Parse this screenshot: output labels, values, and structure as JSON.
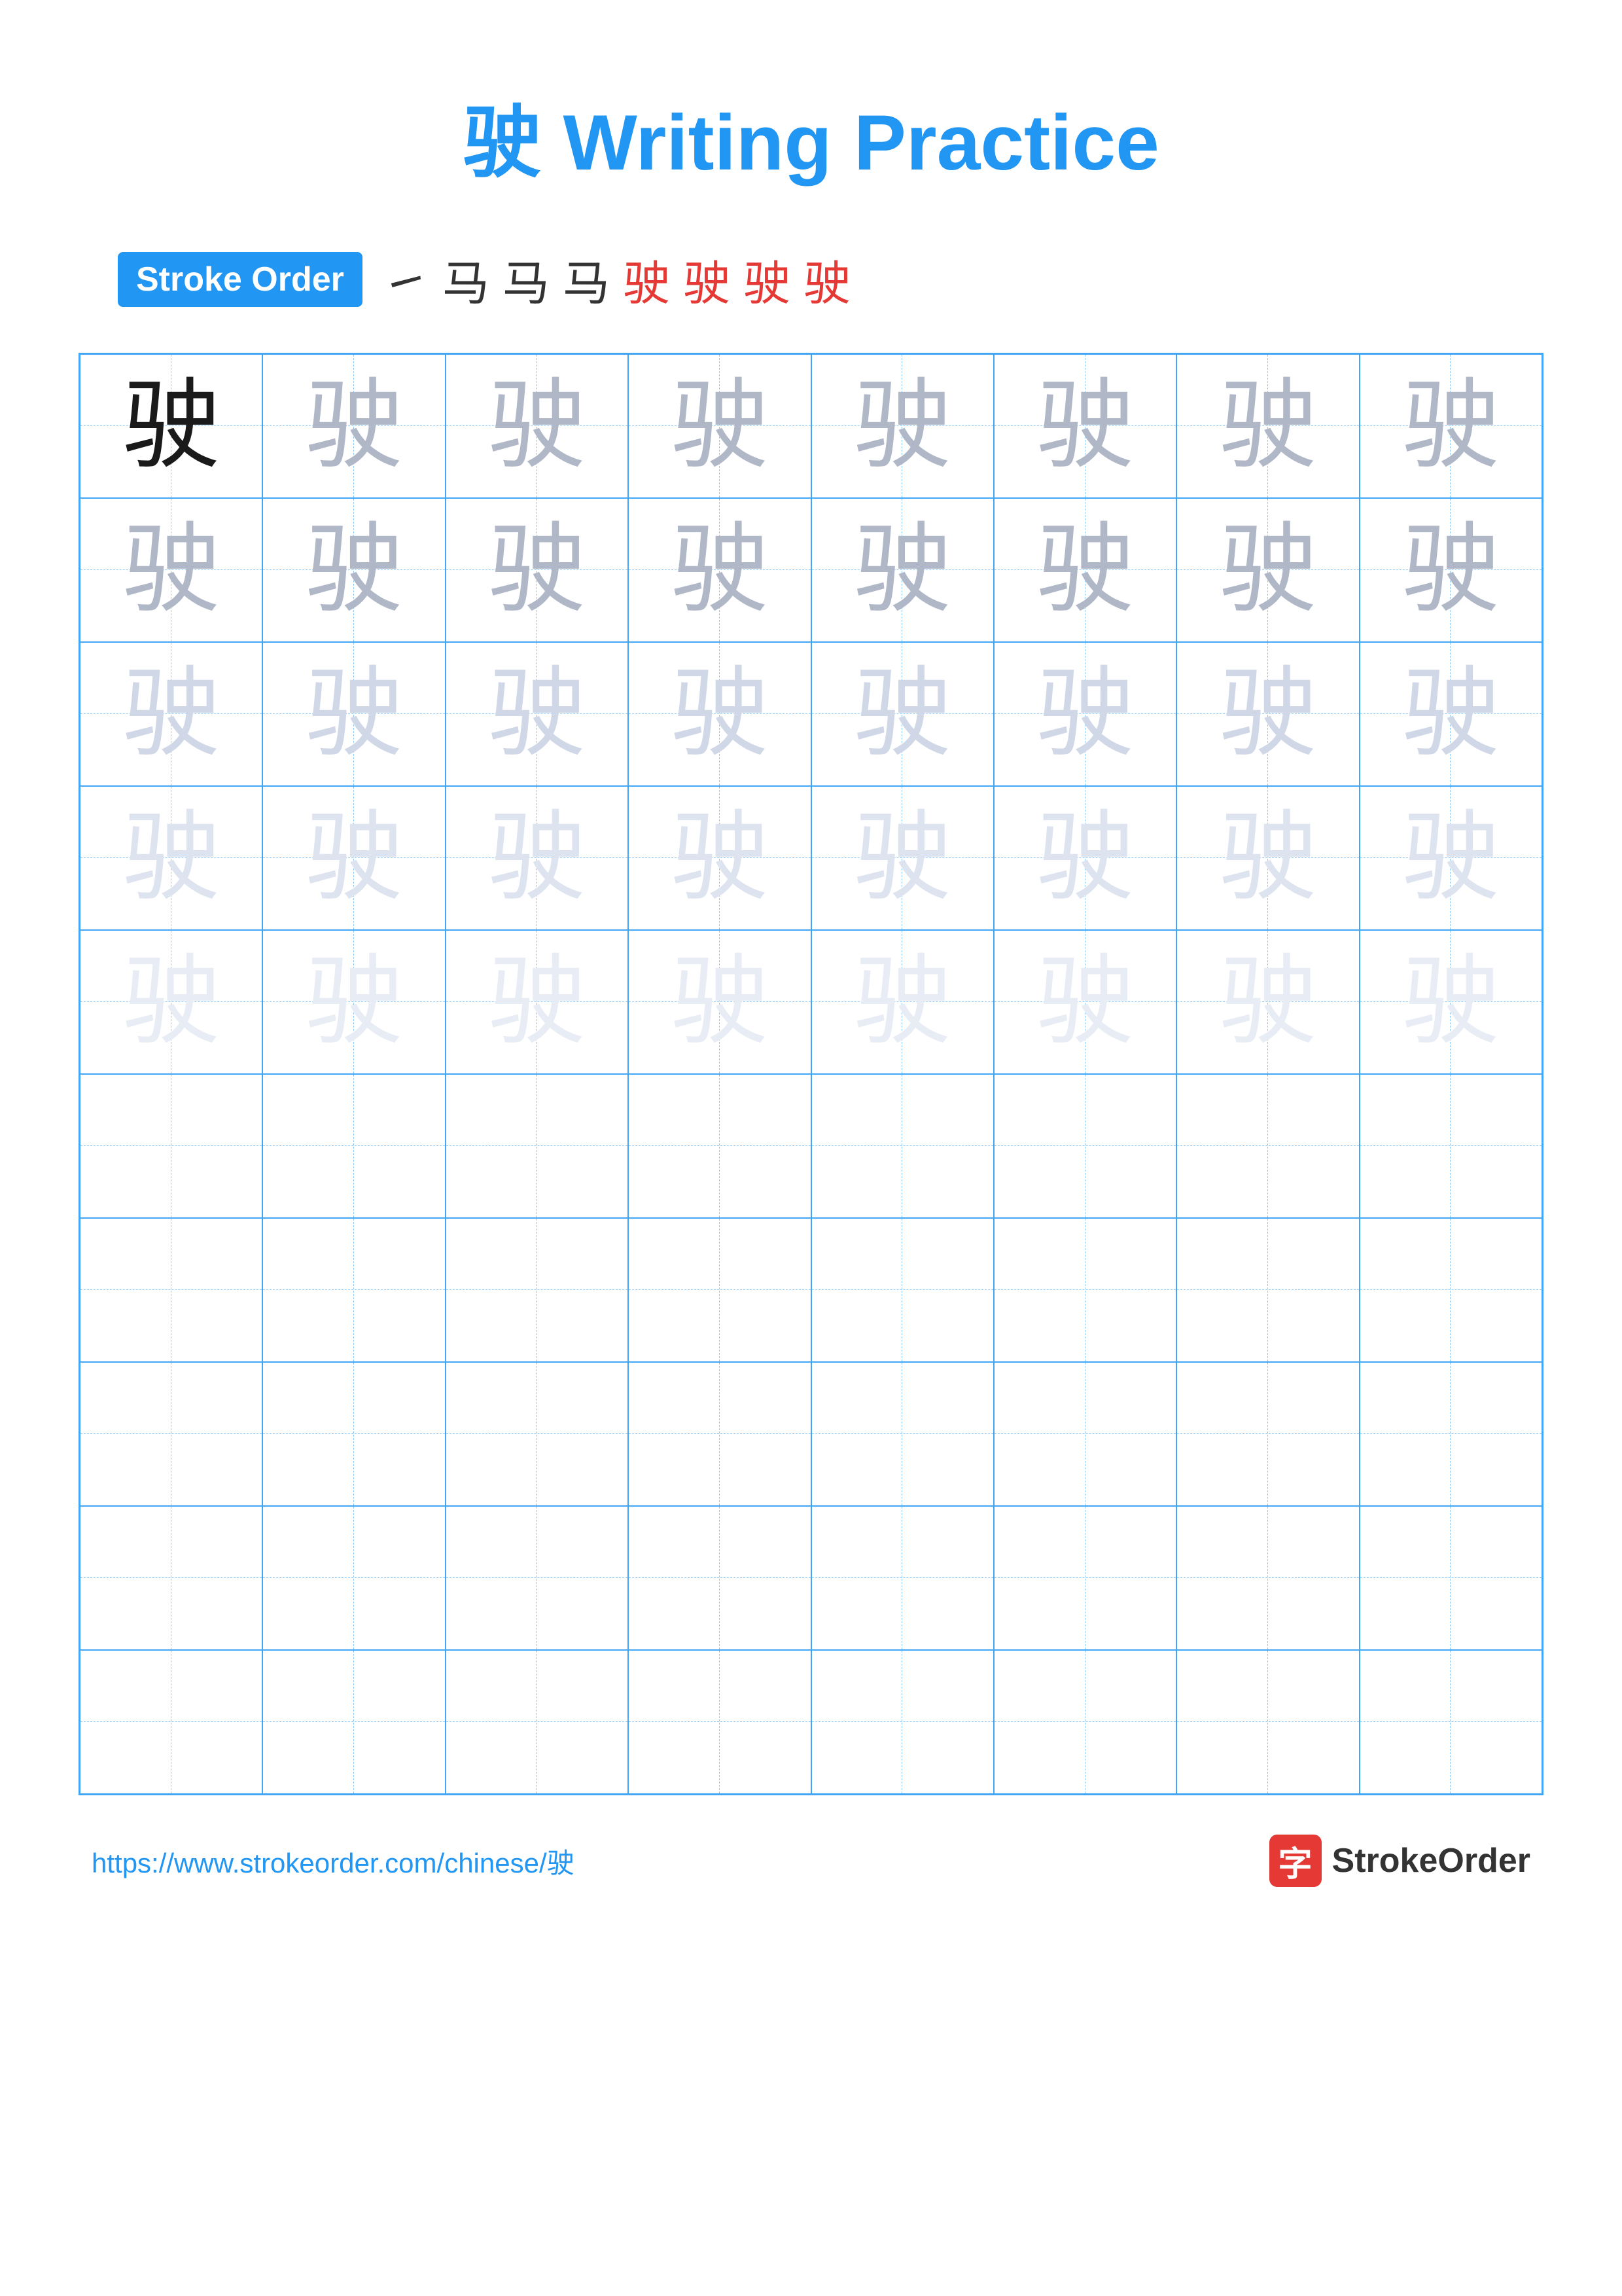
{
  "title": "驶 Writing Practice",
  "stroke_order": {
    "label": "Stroke Order",
    "sequence": [
      "㇀",
      "马",
      "马",
      "马",
      "驶",
      "驶",
      "驶",
      "驶"
    ]
  },
  "character": "驶",
  "rows": [
    {
      "style": "dark",
      "count": 8,
      "first_dark": true
    },
    {
      "style": "medium",
      "count": 8
    },
    {
      "style": "medium",
      "count": 8
    },
    {
      "style": "light",
      "count": 8
    },
    {
      "style": "very-faint",
      "count": 8
    },
    {
      "style": "empty",
      "count": 8
    },
    {
      "style": "empty",
      "count": 8
    },
    {
      "style": "empty",
      "count": 8
    },
    {
      "style": "empty",
      "count": 8
    },
    {
      "style": "empty",
      "count": 8
    }
  ],
  "footer": {
    "url": "https://www.strokeorder.com/chinese/驶",
    "logo_char": "字",
    "logo_name": "StrokeOrder"
  }
}
